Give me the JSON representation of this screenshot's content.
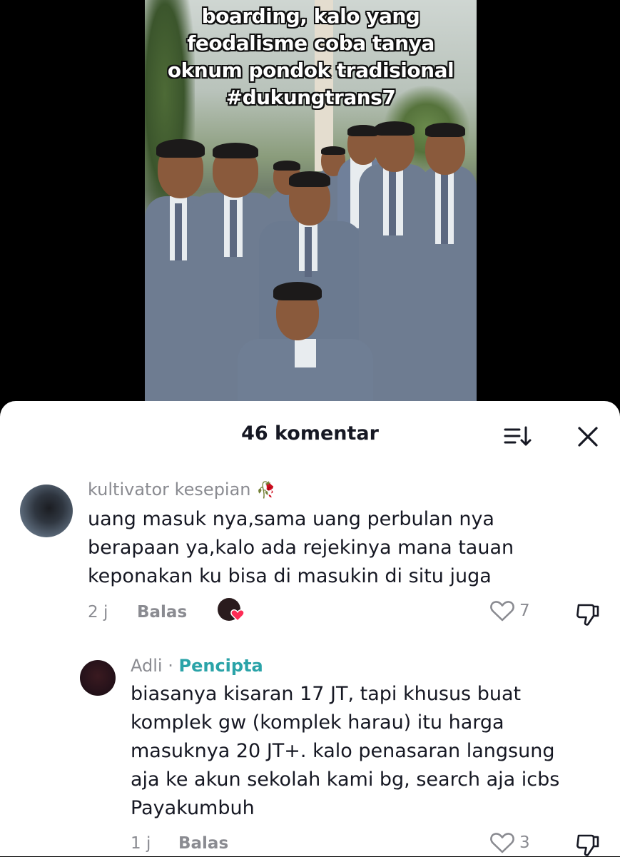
{
  "video": {
    "overlay_lines": [
      "boarding, kalo yang",
      "feodalisme coba tanya",
      "oknum pondok tradisional",
      "#dukungtrans7"
    ]
  },
  "comments_panel": {
    "title": "46 komentar",
    "sort_icon": "sort-icon",
    "close_icon": "close-icon"
  },
  "comments": [
    {
      "username": "kultivator kesepian",
      "username_emoji": "🥀",
      "text_lines": [
        "uang masuk nya,sama uang perbulan nya",
        "berapaan ya,kalo ada rejekinya mana tauan",
        "keponakan ku bisa di masukin di situ juga"
      ],
      "time": "2 j",
      "reply_label": "Balas",
      "likes": "7",
      "creator_liked": true
    },
    {
      "username": "Adli",
      "separator": "·",
      "badge": "Pencipta",
      "text_lines": [
        "biasanya kisaran 17 JT, tapi khusus buat",
        "komplek gw (komplek harau) itu harga",
        "masuknya 20 JT+. kalo penasaran langsung",
        "aja ke akun sekolah kami bg, search aja icbs",
        "Payakumbuh"
      ],
      "time": "1 j",
      "reply_label": "Balas",
      "likes": "3"
    }
  ],
  "colors": {
    "sheet_bg": "#ffffff",
    "text_primary": "#161823",
    "text_secondary": "#8a8b91",
    "creator_badge": "#2aa3a8",
    "heart_pink": "#fe2c55"
  }
}
